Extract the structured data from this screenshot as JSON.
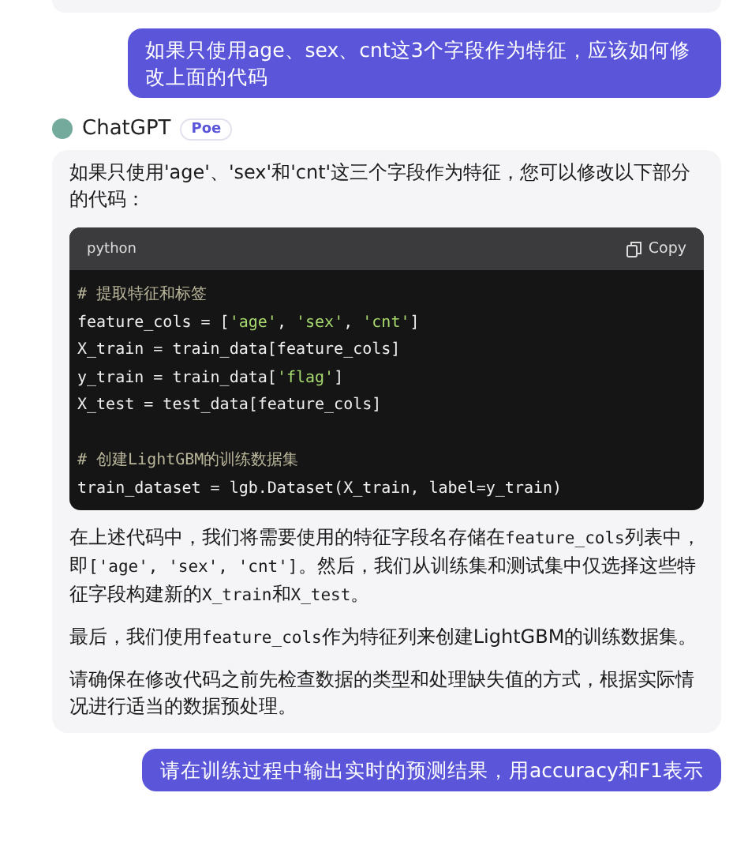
{
  "messages": [
    {
      "kind": "user",
      "text": "如果只使用age、sex、cnt这3个字段作为特征，应该如何修改上面的代码"
    },
    {
      "kind": "bot",
      "name": "ChatGPT",
      "badge": "Poe",
      "intro": "如果只使用'age'、'sex'和'cnt'这三个字段作为特征，您可以修改以下部分的代码：",
      "code": {
        "language": "python",
        "copy": "Copy",
        "lines": [
          {
            "kind": "code",
            "tokens": [
              {
                "kind": "comment",
                "text": "# 提取特征和标签"
              }
            ]
          },
          {
            "kind": "code",
            "tokens": [
              {
                "kind": "plain",
                "text": "feature_cols = ["
              },
              {
                "kind": "string",
                "text": "'age'"
              },
              {
                "kind": "plain",
                "text": ", "
              },
              {
                "kind": "string",
                "text": "'sex'"
              },
              {
                "kind": "plain",
                "text": ", "
              },
              {
                "kind": "string",
                "text": "'cnt'"
              },
              {
                "kind": "plain",
                "text": "]"
              }
            ]
          },
          {
            "kind": "code",
            "tokens": [
              {
                "kind": "plain",
                "text": "X_train = train_data[feature_cols]"
              }
            ]
          },
          {
            "kind": "code",
            "tokens": [
              {
                "kind": "plain",
                "text": "y_train = train_data["
              },
              {
                "kind": "string",
                "text": "'flag'"
              },
              {
                "kind": "plain",
                "text": "]"
              }
            ]
          },
          {
            "kind": "code",
            "tokens": [
              {
                "kind": "plain",
                "text": "X_test = test_data[feature_cols]"
              }
            ]
          },
          {
            "kind": "blank"
          },
          {
            "kind": "code",
            "tokens": [
              {
                "kind": "comment",
                "text": "# 创建LightGBM的训练数据集"
              }
            ]
          },
          {
            "kind": "code",
            "tokens": [
              {
                "kind": "plain",
                "text": "train_dataset = lgb.Dataset(X_train, label=y_train)"
              }
            ]
          }
        ]
      },
      "paragraphs": [
        [
          {
            "kind": "text",
            "text": "在上述代码中，我们将需要使用的特征字段名存储在"
          },
          {
            "kind": "code",
            "text": "feature_cols"
          },
          {
            "kind": "text",
            "text": "列表中，即"
          },
          {
            "kind": "code",
            "text": "['age', 'sex', 'cnt']"
          },
          {
            "kind": "text",
            "text": "。然后，我们从训练集和测试集中仅选择这些特征字段构建新的"
          },
          {
            "kind": "code",
            "text": "X_train"
          },
          {
            "kind": "text",
            "text": "和"
          },
          {
            "kind": "code",
            "text": "X_test"
          },
          {
            "kind": "text",
            "text": "。"
          }
        ],
        [
          {
            "kind": "text",
            "text": "最后，我们使用"
          },
          {
            "kind": "code",
            "text": "feature_cols"
          },
          {
            "kind": "text",
            "text": "作为特征列来创建LightGBM的训练数据集。"
          }
        ],
        [
          {
            "kind": "text",
            "text": "请确保在修改代码之前先检查数据的类型和处理缺失值的方式，根据实际情况进行适当的数据预处理。"
          }
        ]
      ]
    },
    {
      "kind": "user",
      "text": "请在训练过程中输出实时的预测结果，用accuracy和F1表示"
    }
  ]
}
